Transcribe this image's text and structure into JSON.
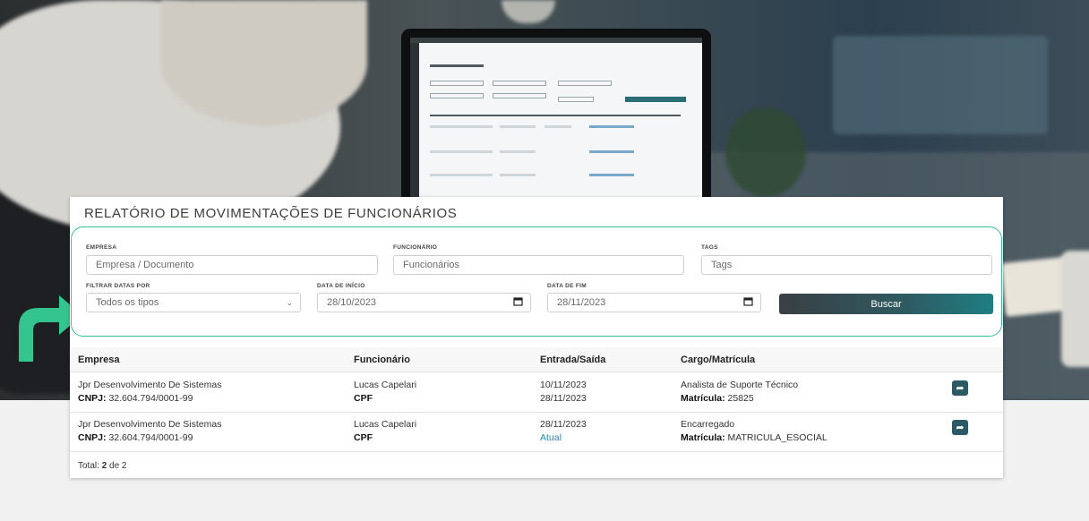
{
  "report": {
    "title": "RELATÓRIO DE MOVIMENTAÇÕES DE FUNCIONÁRIOS"
  },
  "filters": {
    "empresa": {
      "label": "EMPRESA",
      "placeholder": "Empresa / Documento"
    },
    "funcionario": {
      "label": "FUNCIONÁRIO",
      "placeholder": "Funcionários"
    },
    "tags": {
      "label": "TAGS",
      "placeholder": "Tags"
    },
    "filtrar_datas": {
      "label": "FILTRAR DATAS POR",
      "value": "Todos os tipos"
    },
    "data_inicio": {
      "label": "DATA DE INÍCIO",
      "value": "28/10/2023"
    },
    "data_fim": {
      "label": "DATA DE FIM",
      "value": "28/11/2023"
    },
    "search_label": "Buscar"
  },
  "table": {
    "headers": [
      "Empresa",
      "Funcionário",
      "Entrada/Saída",
      "Cargo/Matrícula"
    ],
    "rows": [
      {
        "empresa": "Jpr Desenvolvimento De Sistemas",
        "cnpj_label": "CNPJ:",
        "cnpj": "32.604.794/0001-99",
        "funcionario": "Lucas Capelari",
        "doc_label": "CPF",
        "entrada": "10/11/2023",
        "saida": "28/11/2023",
        "cargo": "Analista de Suporte Técnico",
        "matricula_label": "Matrícula:",
        "matricula": "25825"
      },
      {
        "empresa": "Jpr Desenvolvimento De Sistemas",
        "cnpj_label": "CNPJ:",
        "cnpj": "32.604.794/0001-99",
        "funcionario": "Lucas Capelari",
        "doc_label": "CPF",
        "entrada": "28/11/2023",
        "saida": "Atual",
        "cargo": "Encarregado",
        "matricula_label": "Matrícula:",
        "matricula": "MATRICULA_ESOCIAL"
      }
    ],
    "total_label": "Total:",
    "total_count": "2",
    "total_of": "de 2"
  },
  "icons": {
    "calendar": "calendar-icon",
    "chevron": "chevron-down-icon",
    "share": "share-arrow-icon",
    "arrow_pointer": "curved-arrow-icon"
  },
  "colors": {
    "accent_green": "#37c28f",
    "button_dark": "#2e5b62",
    "link_blue": "#1a8fb8"
  }
}
